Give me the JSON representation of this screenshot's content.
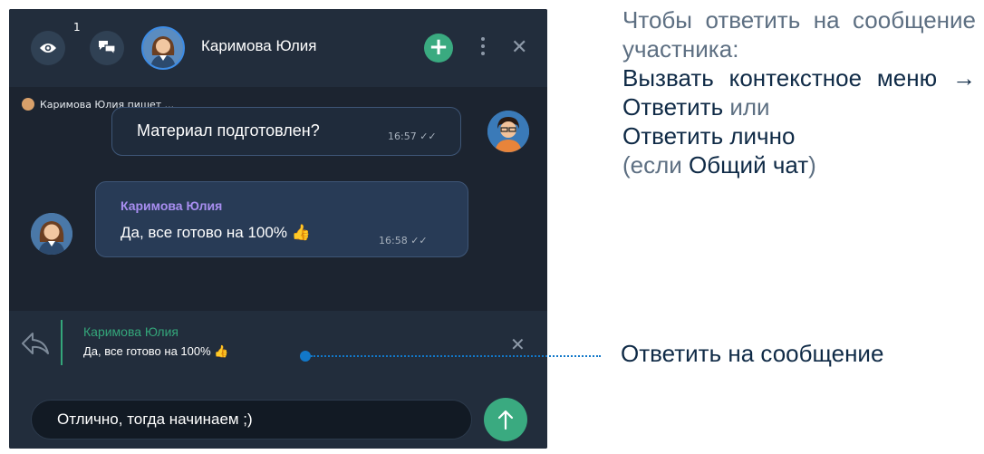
{
  "header": {
    "viewers_count": "1",
    "contact_name": "Каримова Юлия",
    "icons": [
      "eye-icon",
      "chats-icon",
      "plus-icon",
      "more-icon",
      "close-icon"
    ]
  },
  "typing_indicator": "Каримова Юлия пишет ...",
  "messages": [
    {
      "text": "Материал подготовлен?",
      "time": "16:57"
    },
    {
      "author": "Каримова Юлия",
      "text": "Да, все готово на 100% 👍",
      "time": "16:58"
    }
  ],
  "reply": {
    "author": "Каримова Юлия",
    "text": "Да, все готово на 100% 👍"
  },
  "composer": {
    "value": "Отлично, тогда начинаем ;)"
  },
  "annotation": {
    "line1_light": "Чтобы ответить на сообщение участника:",
    "line2": "Вызвать контекстное меню",
    "arrow": " → ",
    "line2b": "Ответить",
    "or": " или ",
    "line3": "Ответить лично",
    "paren_open": "(если ",
    "line4": "Общий чат",
    "paren_close": ")",
    "callout": "Ответить на сообщение"
  },
  "colors": {
    "accent_green": "#3aaa80",
    "accent_blue": "#3d8ce6",
    "author_purple": "#a88ef0",
    "callout_blue": "#1278c9"
  }
}
